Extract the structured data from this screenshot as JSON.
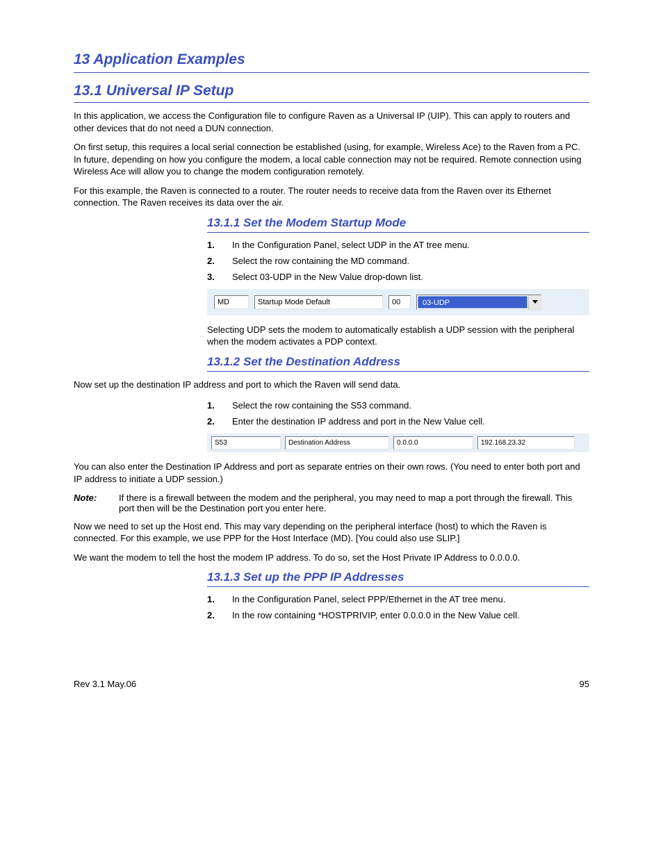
{
  "chapter_title": "13 Application Examples",
  "section_title": "13.1 Universal IP Setup",
  "intro_paragraphs": [
    "In this application, we access the Configuration file to configure Raven as a Universal IP (UIP). This can apply to routers and other devices that do not need a DUN connection.",
    "On first setup, this requires a local serial connection be established (using, for example, Wireless Ace)  to the Raven from a PC. In future, depending on how you configure the modem, a local cable connection may not be required. Remote connection using Wireless Ace will allow you to change the modem configuration remotely.",
    "For this example, the Raven is connected to a router. The router needs to receive data from the Raven over its Ethernet connection. The Raven receives its data over the air."
  ],
  "sub1": {
    "title": "13.1.1 Set the Modem Startup Mode",
    "steps": {
      "1": "In the Configuration Panel, select UDP in the AT tree menu.",
      "2": "Select the row containing the MD command.",
      "3": "Select 03-UDP in the New Value drop-down list."
    },
    "img": {
      "md": "MD",
      "desc": "Startup Mode Default",
      "val": "00",
      "sel": "03-UDP"
    },
    "after": "Selecting UDP sets the modem to automatically establish a UDP session with the peripheral when the modem activates a PDP context."
  },
  "sub2": {
    "title": "13.1.2 Set the Destination Address",
    "lead": "Now set up the destination IP address and port to which the Raven will send data.",
    "steps": {
      "1": "Select the row containing the S53 command.",
      "2": "Enter the destination IP address and port in the New Value cell."
    },
    "img": {
      "s53": "S53",
      "desc": "Destination Address",
      "val": "0.0.0.0",
      "newv": "192.168.23.32"
    },
    "after": "You can also enter the Destination IP Address and port as separate entries on their own rows. (You need to enter both port and IP address to initiate a UDP session.)",
    "note_label": "Note:",
    "note": "If there is a firewall between the modem and the peripheral, you may need to map a port through the firewall. This port then will be the Destination port you enter here.",
    "final": [
      "Now we need to set up the Host end. This may vary depending on the peripheral interface (host) to which the Raven is connected. For this example, we use PPP for the Host Interface (MD). [You could also use SLIP.]",
      "We want the modem to tell the host the modem IP address. To do so, set the Host Private IP Address to 0.0.0.0."
    ]
  },
  "sub3": {
    "title": "13.1.3 Set up the PPP IP Addresses",
    "steps": {
      "1": "In the Configuration Panel, select PPP/Ethernet in the AT tree menu.",
      "2": "In the row containing *HOSTPRIVIP, enter 0.0.0.0 in the New Value cell."
    }
  },
  "footer": {
    "left": "Rev 3.1 May.06",
    "right": "95"
  }
}
